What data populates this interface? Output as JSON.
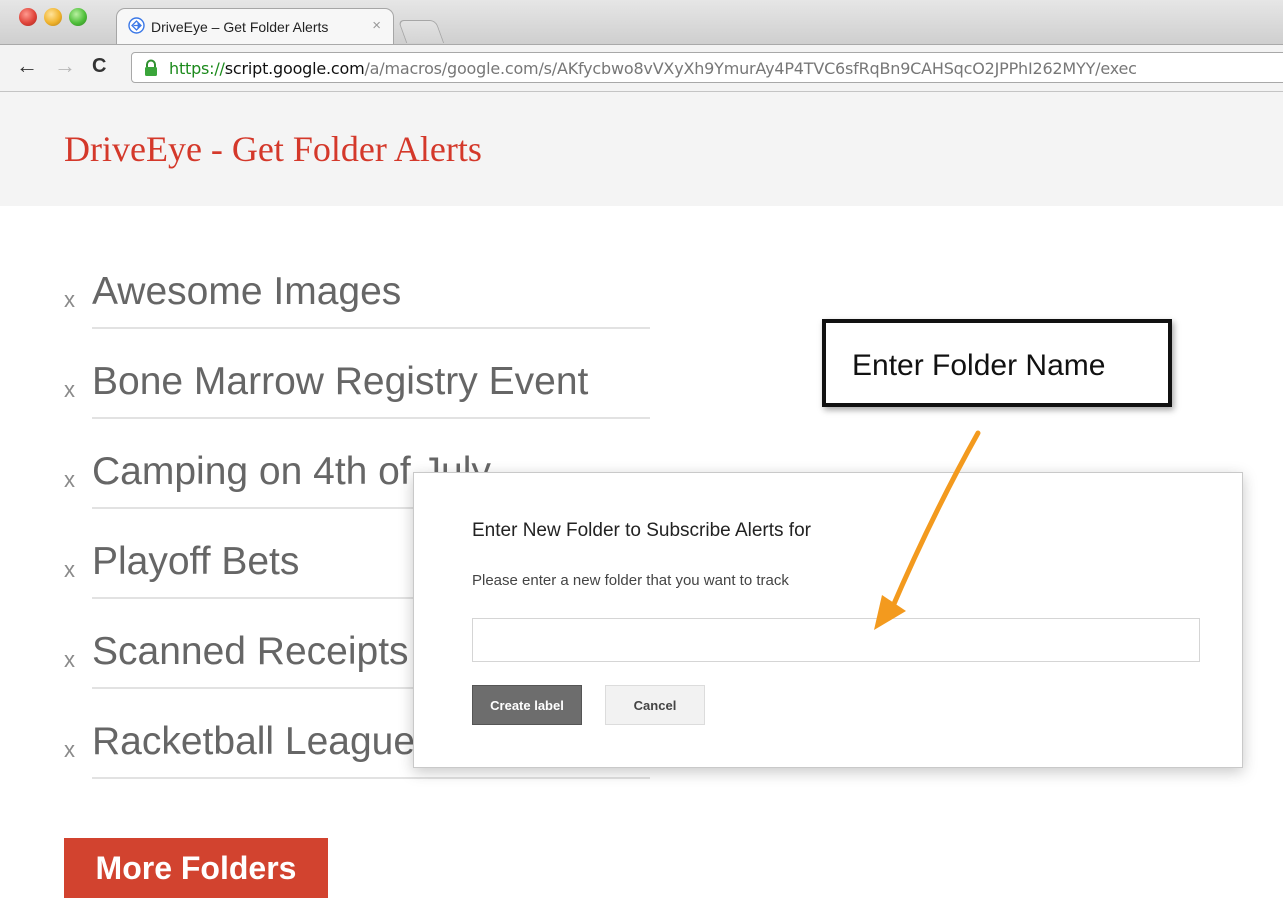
{
  "browser": {
    "tab_title": "DriveEye – Get Folder Alerts",
    "tab_close": "×",
    "url_scheme": "https://",
    "url_host": "script.google.com",
    "url_path": "/a/macros/google.com/s/AKfycbwo8vVXyXh9YmurAy4P4TVC6sfRqBn9CAHSqcO2JPPhI262MYY/exec",
    "back_glyph": "←",
    "forward_glyph": "→",
    "reload_glyph": "C"
  },
  "app": {
    "title": "DriveEye - Get Folder Alerts"
  },
  "folders": {
    "remove_glyph": "x",
    "items": [
      "Awesome Images",
      "Bone Marrow Registry Event",
      "Camping on 4th of July",
      "Playoff Bets",
      "Scanned Receipts",
      "Racketball League"
    ]
  },
  "more_button": "More Folders",
  "dialog": {
    "title": "Enter New Folder to Subscribe Alerts for",
    "message": "Please enter a new folder that you want to track",
    "input_value": "",
    "create_label": "Create label",
    "cancel_label": "Cancel"
  },
  "annotation": {
    "text": "Enter Folder Name",
    "arrow_color": "#f39a1e"
  },
  "colors": {
    "accent_red": "#d2432f",
    "title_red": "#d4382a"
  },
  "icons": {
    "tab": "drive-app-icon",
    "lock": "lock-icon",
    "arrow": "orange-arrow-icon"
  }
}
